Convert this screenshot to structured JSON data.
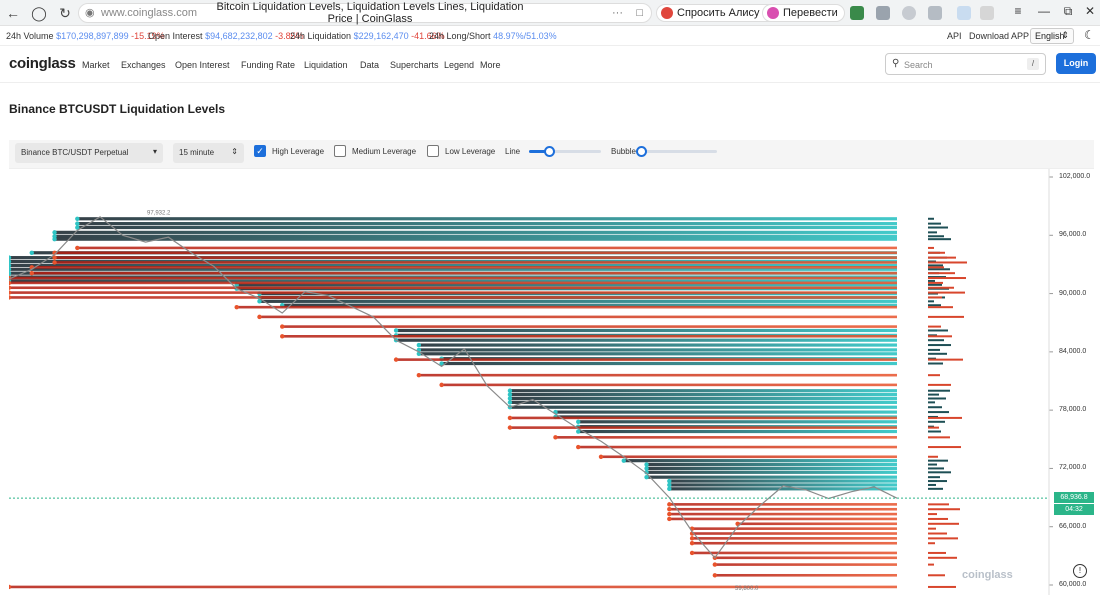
{
  "browser": {
    "url": "www.coinglass.com",
    "tab_title": "Bitcoin Liquidation Levels, Liquidation Levels Lines, Liquidation Price | CoinGlass",
    "alisa_chip": "Спросить Алису AI",
    "translate_chip": "Перевести"
  },
  "ticker": {
    "volume_label": "24h Volume",
    "volume_value": "$170,298,897,899",
    "volume_change": "-15.19%",
    "oi_label": "Open Interest",
    "oi_value": "$94,682,232,802",
    "oi_change": "-3.85%",
    "liq_label": "24h Liquidation",
    "liq_value": "$229,162,470",
    "liq_change": "-41.66%",
    "ls_label": "24h Long/Short",
    "ls_value": "48.97%/51.03%",
    "api": "API",
    "download": "Download APP",
    "language": "English"
  },
  "nav": {
    "logo": "coinglass",
    "items": [
      "Market",
      "Exchanges",
      "Open Interest",
      "Funding Rate",
      "Liquidation",
      "Data",
      "Supercharts",
      "Legend",
      "More"
    ],
    "search_placeholder": "Search",
    "search_shortcut": "/",
    "login": "Login"
  },
  "page_title": "Binance BTCUSDT Liquidation Levels",
  "controls": {
    "pair_select": "Binance BTC/USDT Perpetual",
    "interval_select": "15 minute",
    "high_leverage": "High Leverage",
    "high_leverage_checked": true,
    "medium_leverage": "Medium Leverage",
    "medium_leverage_checked": false,
    "low_leverage": "Low Leverage",
    "low_leverage_checked": false,
    "line_label": "Line",
    "line_value": 0.28,
    "bubble_label": "Bubble",
    "bubble_value": 0.0
  },
  "chart_data": {
    "type": "line",
    "title": "",
    "y_ticks": [
      "102,000.0",
      "96,000.0",
      "90,000.0",
      "84,000.0",
      "78,000.0",
      "72,000.0",
      "66,000.0",
      "60,000.0"
    ],
    "ylim": [
      60000,
      102000
    ],
    "current_price": "68,936.8",
    "countdown": "04:32",
    "annotation_high": "97,932.2",
    "annotation_low": "59,800.0",
    "price_series": [
      91500,
      92500,
      94000,
      96500,
      97900,
      96000,
      95300,
      95800,
      94200,
      92800,
      90500,
      89500,
      88000,
      90200,
      89800,
      88700,
      87600,
      85200,
      84000,
      82500,
      84300,
      80500,
      78300,
      79100,
      77600,
      76100,
      74800,
      73200,
      71500,
      69000,
      65500,
      62800,
      66000,
      68200,
      70200,
      69800,
      68900,
      69600,
      70100,
      68936.8
    ],
    "short_liq_levels": [
      97700,
      97200,
      96800,
      96300,
      95900,
      95600,
      94200,
      93700,
      93300,
      92900,
      92500,
      92100,
      91700,
      91300,
      90900,
      90500,
      90000,
      89600,
      89200,
      88800,
      86200,
      85700,
      85200,
      84700,
      84200,
      83800,
      83300,
      82800,
      80000,
      79600,
      79200,
      78800,
      78300,
      77800,
      77300,
      76800,
      76300,
      75800,
      72800,
      72400,
      72000,
      71600,
      71100,
      70700,
      70300,
      69900
    ],
    "long_liq_levels": [
      94700,
      94200,
      93700,
      93200,
      92700,
      92100,
      91600,
      91100,
      90600,
      90100,
      89600,
      88600,
      87600,
      86600,
      85600,
      83200,
      81600,
      80600,
      77200,
      76200,
      75200,
      74200,
      73200,
      68300,
      67800,
      67300,
      66800,
      66300,
      65800,
      65300,
      64800,
      64300,
      63300,
      62800,
      62100,
      61000,
      59800
    ],
    "colors": {
      "short_liq": "#2ec4c4",
      "long_liq": "#e8532c",
      "price_line": "#8a8a8a",
      "current_price": "#2bb589"
    }
  },
  "watermark": "coinglass"
}
